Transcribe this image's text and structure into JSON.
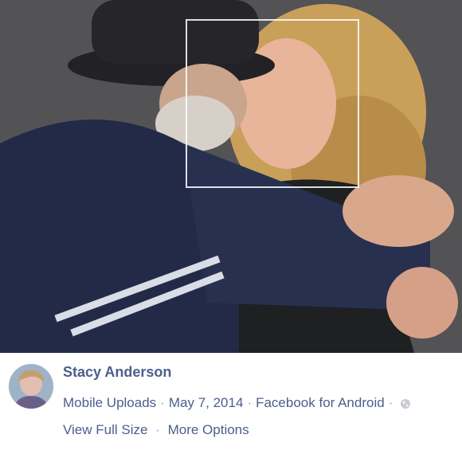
{
  "post": {
    "author_name": "Stacy Anderson",
    "album": "Mobile Uploads",
    "date": "May 7, 2014",
    "source_app": "Facebook for Android",
    "privacy_icon": "globe-icon",
    "separator": "·"
  },
  "actions": {
    "view_full_size": "View Full Size",
    "more_options": "More Options"
  },
  "colors": {
    "link_blue": "#4b5f8c",
    "separator_gray": "#9aa3b0"
  }
}
